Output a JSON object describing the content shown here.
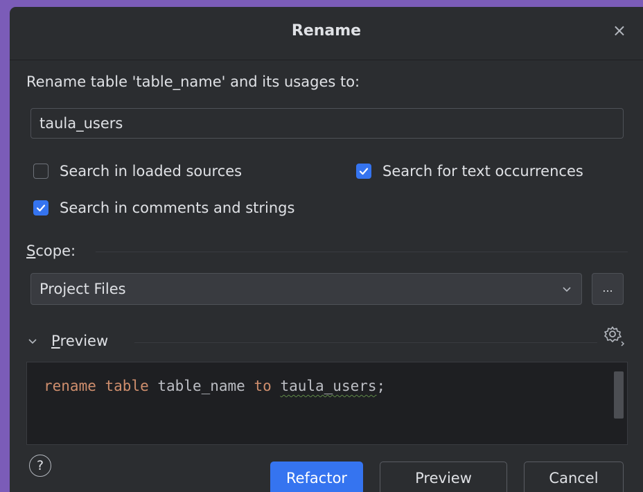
{
  "dialog": {
    "title": "Rename",
    "close_icon": "×",
    "prompt": "Rename table 'table_name' and its usages to:",
    "new_name": "taula_users"
  },
  "options": {
    "search_loaded_sources": {
      "label": "Search in loaded sources",
      "checked": false
    },
    "search_text_occurrences": {
      "label": "Search for text occurrences",
      "checked": true
    },
    "search_comments_strings": {
      "label": "Search in comments and strings",
      "checked": true
    }
  },
  "scope": {
    "label_mnemonic": "S",
    "label_rest": "cope:",
    "selected": "Project Files",
    "more_button": "..."
  },
  "preview_section": {
    "label_mnemonic": "P",
    "label_rest": "review",
    "code": {
      "kw1": "rename",
      "kw2": "table",
      "ident": "table_name",
      "kw3": "to",
      "new_ident": "taula_users",
      "terminator": ";"
    }
  },
  "buttons": {
    "help": "?",
    "refactor": "Refactor",
    "preview": "Preview",
    "cancel": "Cancel"
  },
  "colors": {
    "accent": "#3574f0",
    "background": "#2b2d30",
    "keyword": "#cf8e6d",
    "frame": "#7b5cb8"
  }
}
